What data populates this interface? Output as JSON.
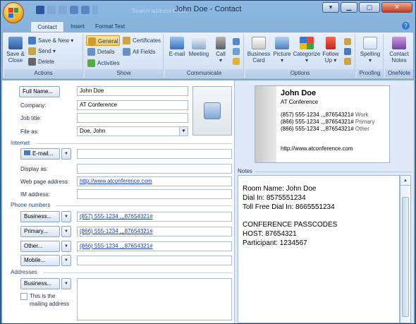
{
  "window": {
    "title": "John Doe - Contact",
    "search_placeholder": "Search address books"
  },
  "tabs": [
    "Contact",
    "Insert",
    "Format Text"
  ],
  "ribbon": {
    "actions": {
      "save_close": "Save &\nClose",
      "save_new": "Save & New",
      "send": "Send",
      "delete": "Delete",
      "label": "Actions"
    },
    "show": {
      "general": "General",
      "details": "Details",
      "activities": "Activities",
      "certificates": "Certificates",
      "all_fields": "All Fields",
      "label": "Show"
    },
    "communicate": {
      "email": "E-mail",
      "meeting": "Meeting",
      "call": "Call",
      "label": "Communicate"
    },
    "options": {
      "business_card": "Business\nCard",
      "picture": "Picture",
      "categorize": "Categorize",
      "follow_up": "Follow\nUp",
      "label": "Options"
    },
    "proofing": {
      "spelling": "Spelling",
      "label": "Proofing"
    },
    "onenote": {
      "contact_notes": "Contact\nNotes",
      "label": "OneNote"
    }
  },
  "form": {
    "full_name_button": "Full Name...",
    "full_name": "John Doe",
    "company_label": "Company:",
    "company": "AT Conference",
    "job_title_label": "Job title:",
    "job_title": "",
    "file_as_label": "File as:",
    "file_as": "Doe, John",
    "internet_header": "Internet",
    "email_button": "E-mail...",
    "email": "",
    "display_as_label": "Display as:",
    "display_as": "",
    "web_label": "Web page address:",
    "web": "http://www.atconference.com",
    "im_label": "IM address:",
    "im": "",
    "phone_header": "Phone numbers",
    "phones": [
      {
        "button": "Business...",
        "value": "(857) 555-1234 ,,,87654321#"
      },
      {
        "button": "Primary...",
        "value": "(866) 555-1234 ,,,87654321#"
      },
      {
        "button": "Other...",
        "value": "(866) 555-1234 ,,,87654321#"
      },
      {
        "button": "Mobile...",
        "value": ""
      }
    ],
    "addresses_header": "Addresses",
    "address_button": "Business...",
    "mailing_label": "This is the\nmailing address"
  },
  "card": {
    "name": "John Doe",
    "company": "AT Conference",
    "phones": [
      {
        "number": "(857) 555-1234 ,,,87654321#",
        "type": "Work"
      },
      {
        "number": "(866) 555-1234 ,,,87654321#",
        "type": "Primary"
      },
      {
        "number": "(866) 555-1234 ,,,87654321#",
        "type": "Other"
      }
    ],
    "web": "http://www.atconference.com"
  },
  "notes": {
    "label": "Notes",
    "lines": [
      "Room Name: John Doe",
      "Dial In: 8575551234",
      "Toll Free Dial In: 8665551234",
      "",
      "CONFERENCE PASSCODES",
      "HOST: 87654321",
      "Participant: 1234567"
    ]
  }
}
